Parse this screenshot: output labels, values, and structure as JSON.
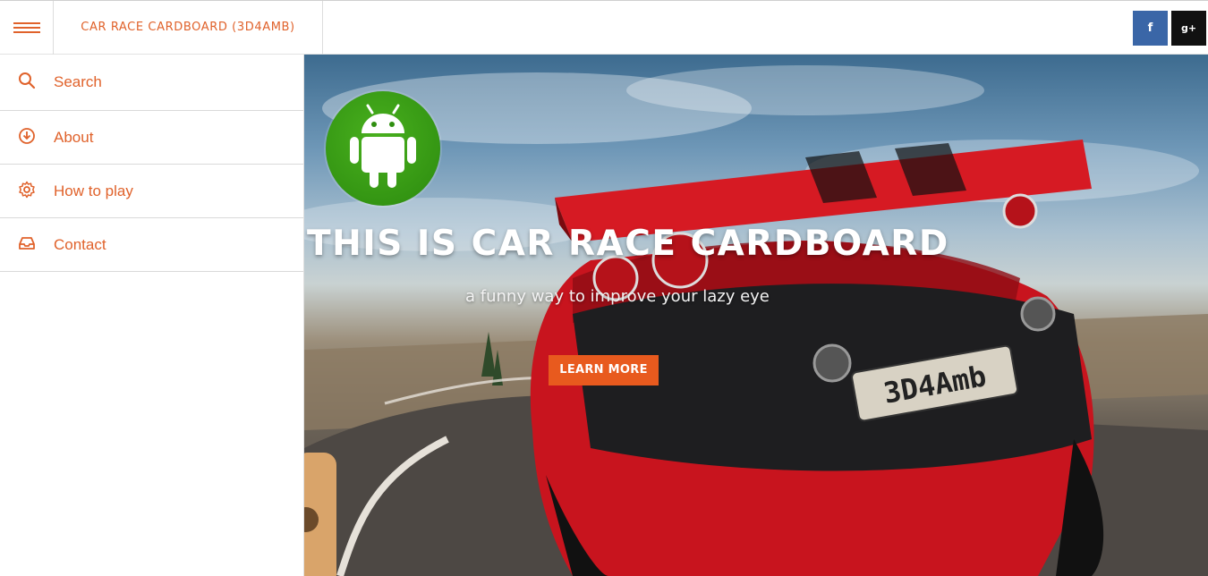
{
  "header": {
    "site_title": "CAR RACE CARDBOARD (3D4AMB)",
    "menu_icon": "hamburger-icon",
    "social": [
      {
        "label": "f",
        "icon": "facebook-icon",
        "color": "#3a66a7"
      },
      {
        "label": "g+",
        "icon": "google-plus-icon",
        "color": "#111111"
      }
    ]
  },
  "sidebar": {
    "items": [
      {
        "label": "Search",
        "icon": "search-icon"
      },
      {
        "label": "About",
        "icon": "download-circle-icon"
      },
      {
        "label": "How to play",
        "icon": "gear-icon"
      },
      {
        "label": "Contact",
        "icon": "inbox-icon"
      }
    ]
  },
  "hero": {
    "badge_icon": "android-icon",
    "title": "THIS IS CAR RACE CARDBOARD",
    "subtitle": "a funny way to improve your lazy eye",
    "button_label": "LEARN MORE",
    "plate_text": "3D4Amb"
  },
  "colors": {
    "accent": "#e0622b",
    "button": "#e85a1e",
    "android_green": "#3a9e14"
  }
}
